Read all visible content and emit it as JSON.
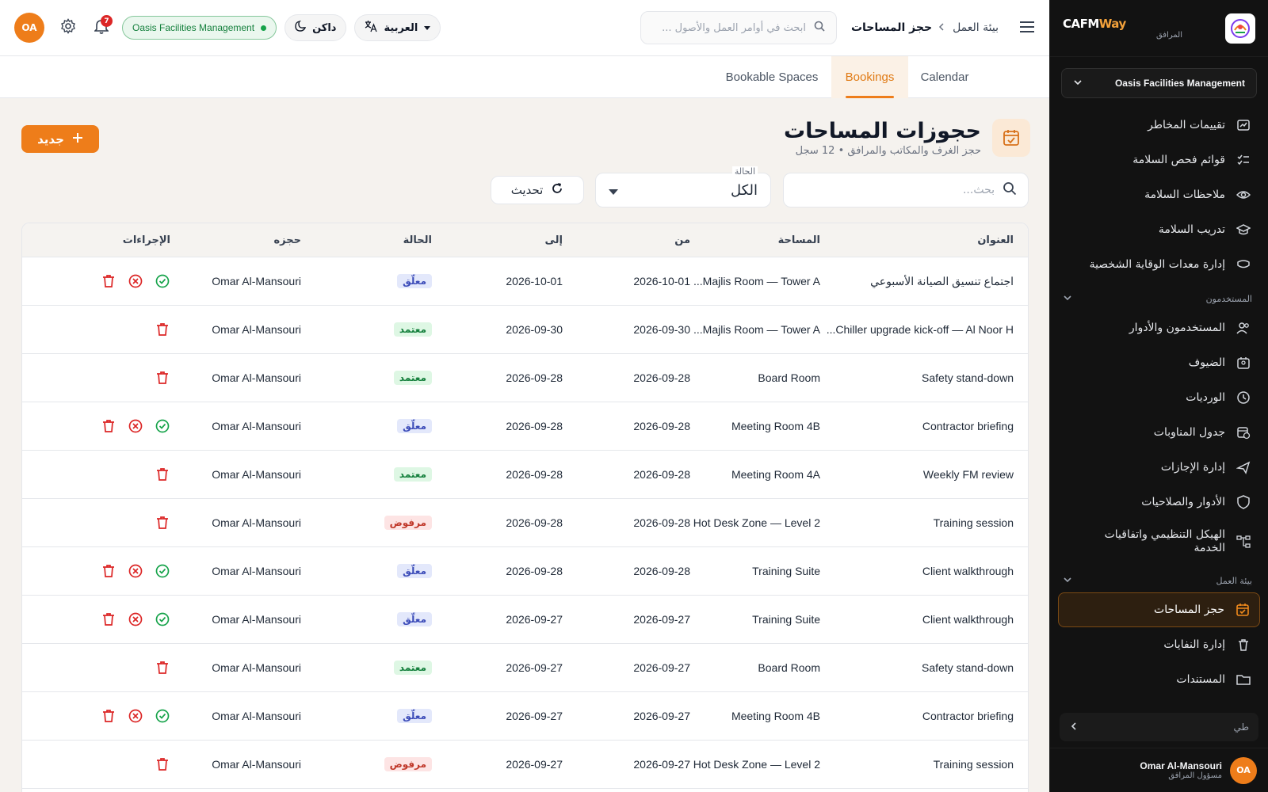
{
  "sidebar": {
    "brand_part1": "CAFM",
    "brand_part2": "Way",
    "brand_sub": "المرافق",
    "org_select": "Oasis Facilities Management",
    "items_top": [
      {
        "label": "تقييمات المخاطر",
        "icon": "chart-icon"
      },
      {
        "label": "قوائم فحص السلامة",
        "icon": "checklist-icon"
      },
      {
        "label": "ملاحظات السلامة",
        "icon": "eye-icon"
      },
      {
        "label": "تدريب السلامة",
        "icon": "graduation-cap-icon"
      },
      {
        "label": "إدارة معدات الوقاية الشخصية",
        "icon": "ppe-icon"
      }
    ],
    "section_users": "المستخدمون",
    "items_users": [
      {
        "label": "المستخدمون والأدوار",
        "icon": "users-icon"
      },
      {
        "label": "الضيوف",
        "icon": "guest-icon"
      },
      {
        "label": "الورديات",
        "icon": "clock-icon"
      },
      {
        "label": "جدول المناوبات",
        "icon": "calendar-clock-icon"
      },
      {
        "label": "إدارة الإجازات",
        "icon": "plane-icon"
      },
      {
        "label": "الأدوار والصلاحيات",
        "icon": "shield-icon"
      },
      {
        "label": "الهيكل التنظيمي واتفاقيات الخدمة",
        "icon": "org-chart-icon"
      }
    ],
    "section_workplace": "بيئة العمل",
    "items_workplace": [
      {
        "label": "حجز المساحات",
        "icon": "calendar-check-icon",
        "active": true
      },
      {
        "label": "إدارة النفايات",
        "icon": "trash-icon"
      },
      {
        "label": "المستندات",
        "icon": "folder-icon"
      }
    ],
    "collapse_label": "طي",
    "user_initials": "OA",
    "user_name": "Omar Al-Mansouri",
    "user_role": "مسؤول المرافق"
  },
  "topbar": {
    "breadcrumb_root": "بيئة العمل",
    "breadcrumb_current": "حجز المساحات",
    "search_placeholder": "ابحث في أوامر العمل والأصول ...",
    "language": "العربية",
    "theme": "داكن",
    "org_pill": "Oasis Facilities Management",
    "notification_count": "7",
    "avatar_initials": "OA"
  },
  "tabs": [
    {
      "label": "Calendar",
      "active": false
    },
    {
      "label": "Bookings",
      "active": true
    },
    {
      "label": "Bookable Spaces",
      "active": false
    }
  ],
  "page": {
    "title": "حجوزات المساحات",
    "subtitle": "حجز الغرف والمكاتب والمرافق",
    "record_count": "12 سجل",
    "new_button": "جديد",
    "search_placeholder": "بحث...",
    "status_label": "الحالة",
    "status_value": "الكل",
    "refresh_button": "تحديث"
  },
  "colors": {
    "accent": "#ee7d1a",
    "sidebar_bg": "#121212",
    "pending": "#3b4bb8",
    "approved": "#15803d",
    "rejected": "#c0392b"
  },
  "table": {
    "headers": {
      "title": "العنوان",
      "space": "المساحة",
      "from": "من",
      "to": "إلى",
      "status": "الحالة",
      "booked_by": "حجزه",
      "actions": "الإجراءات"
    },
    "rows": [
      {
        "title": "اجتماع تنسيق الصيانة الأسبوعي",
        "space": "Majlis Room — Tower A...",
        "from": "2026-10-01",
        "to": "2026-10-01",
        "status": "معلّق",
        "status_kind": "pending",
        "booked_by": "Omar Al-Mansouri"
      },
      {
        "title": "Chiller upgrade kick-off — Al Noor H...",
        "space": "Majlis Room — Tower A...",
        "from": "2026-09-30",
        "to": "2026-09-30",
        "status": "معتمد",
        "status_kind": "approved",
        "booked_by": "Omar Al-Mansouri"
      },
      {
        "title": "Safety stand-down",
        "space": "Board Room",
        "from": "2026-09-28",
        "to": "2026-09-28",
        "status": "معتمد",
        "status_kind": "approved",
        "booked_by": "Omar Al-Mansouri"
      },
      {
        "title": "Contractor briefing",
        "space": "Meeting Room 4B",
        "from": "2026-09-28",
        "to": "2026-09-28",
        "status": "معلّق",
        "status_kind": "pending",
        "booked_by": "Omar Al-Mansouri"
      },
      {
        "title": "Weekly FM review",
        "space": "Meeting Room 4A",
        "from": "2026-09-28",
        "to": "2026-09-28",
        "status": "معتمد",
        "status_kind": "approved",
        "booked_by": "Omar Al-Mansouri"
      },
      {
        "title": "Training session",
        "space": "Hot Desk Zone — Level 2",
        "from": "2026-09-28",
        "to": "2026-09-28",
        "status": "مرفوض",
        "status_kind": "rejected",
        "booked_by": "Omar Al-Mansouri"
      },
      {
        "title": "Client walkthrough",
        "space": "Training Suite",
        "from": "2026-09-28",
        "to": "2026-09-28",
        "status": "معلّق",
        "status_kind": "pending",
        "booked_by": "Omar Al-Mansouri"
      },
      {
        "title": "Client walkthrough",
        "space": "Training Suite",
        "from": "2026-09-27",
        "to": "2026-09-27",
        "status": "معلّق",
        "status_kind": "pending",
        "booked_by": "Omar Al-Mansouri"
      },
      {
        "title": "Safety stand-down",
        "space": "Board Room",
        "from": "2026-09-27",
        "to": "2026-09-27",
        "status": "معتمد",
        "status_kind": "approved",
        "booked_by": "Omar Al-Mansouri"
      },
      {
        "title": "Contractor briefing",
        "space": "Meeting Room 4B",
        "from": "2026-09-27",
        "to": "2026-09-27",
        "status": "معلّق",
        "status_kind": "pending",
        "booked_by": "Omar Al-Mansouri"
      },
      {
        "title": "Training session",
        "space": "Hot Desk Zone — Level 2",
        "from": "2026-09-27",
        "to": "2026-09-27",
        "status": "مرفوض",
        "status_kind": "rejected",
        "booked_by": "Omar Al-Mansouri"
      }
    ]
  }
}
